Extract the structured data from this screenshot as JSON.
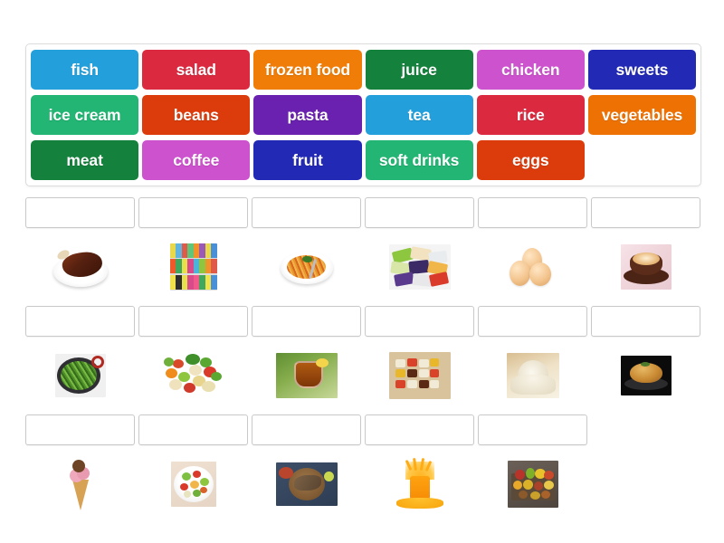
{
  "activity": {
    "type": "match-up",
    "title": "Food vocabulary match-up"
  },
  "wordbank": {
    "rows": [
      [
        {
          "label": "fish",
          "color": "#23a0dc"
        },
        {
          "label": "salad",
          "color": "#db2a3f"
        },
        {
          "label": "frozen food",
          "color": "#ef7d08"
        },
        {
          "label": "juice",
          "color": "#14813c"
        },
        {
          "label": "chicken",
          "color": "#cd52cd"
        },
        {
          "label": "sweets",
          "color": "#2229b5"
        }
      ],
      [
        {
          "label": "ice cream",
          "color": "#22b573"
        },
        {
          "label": "beans",
          "color": "#dc3c0c"
        },
        {
          "label": "pasta",
          "color": "#6a21b0"
        },
        {
          "label": "tea",
          "color": "#23a0dc"
        },
        {
          "label": "rice",
          "color": "#db2a3f"
        },
        {
          "label": "vegetables",
          "color": "#ee7203"
        }
      ],
      [
        {
          "label": "meat",
          "color": "#14813c"
        },
        {
          "label": "coffee",
          "color": "#cd52cd"
        },
        {
          "label": "fruit",
          "color": "#2229b5"
        },
        {
          "label": "soft drinks",
          "color": "#22b573"
        },
        {
          "label": "eggs",
          "color": "#dc3c0c"
        },
        {
          "label": "",
          "color": "",
          "empty": true
        }
      ]
    ]
  },
  "answers": {
    "dropzone_placeholder": "",
    "rows": [
      [
        {
          "image_name": "meat-on-plate-image",
          "answer": ""
        },
        {
          "image_name": "soft-drink-bottles-image",
          "answer": ""
        },
        {
          "image_name": "pasta-plate-image",
          "answer": ""
        },
        {
          "image_name": "frozen-food-packets-image",
          "answer": ""
        },
        {
          "image_name": "eggs-image",
          "answer": ""
        },
        {
          "image_name": "coffee-cup-image",
          "answer": ""
        }
      ],
      [
        {
          "image_name": "green-beans-pan-image",
          "answer": ""
        },
        {
          "image_name": "mixed-vegetables-image",
          "answer": ""
        },
        {
          "image_name": "tea-glass-image",
          "answer": ""
        },
        {
          "image_name": "food-tray-image",
          "answer": ""
        },
        {
          "image_name": "rice-scoop-image",
          "answer": ""
        },
        {
          "image_name": "roast-chicken-image",
          "answer": ""
        }
      ],
      [
        {
          "image_name": "ice-cream-cone-image",
          "answer": ""
        },
        {
          "image_name": "salad-bowl-image",
          "answer": ""
        },
        {
          "image_name": "fish-platter-image",
          "answer": ""
        },
        {
          "image_name": "orange-juice-image",
          "answer": ""
        },
        {
          "image_name": "fruit-crate-image",
          "answer": ""
        },
        {
          "image_name": "",
          "answer": "",
          "blank": true
        }
      ]
    ]
  },
  "colors": {
    "page_background": "#ffffff",
    "panel_border": "#dcdcdc",
    "dropzone_border": "#c9c9c9",
    "tile_text": "#ffffff"
  }
}
